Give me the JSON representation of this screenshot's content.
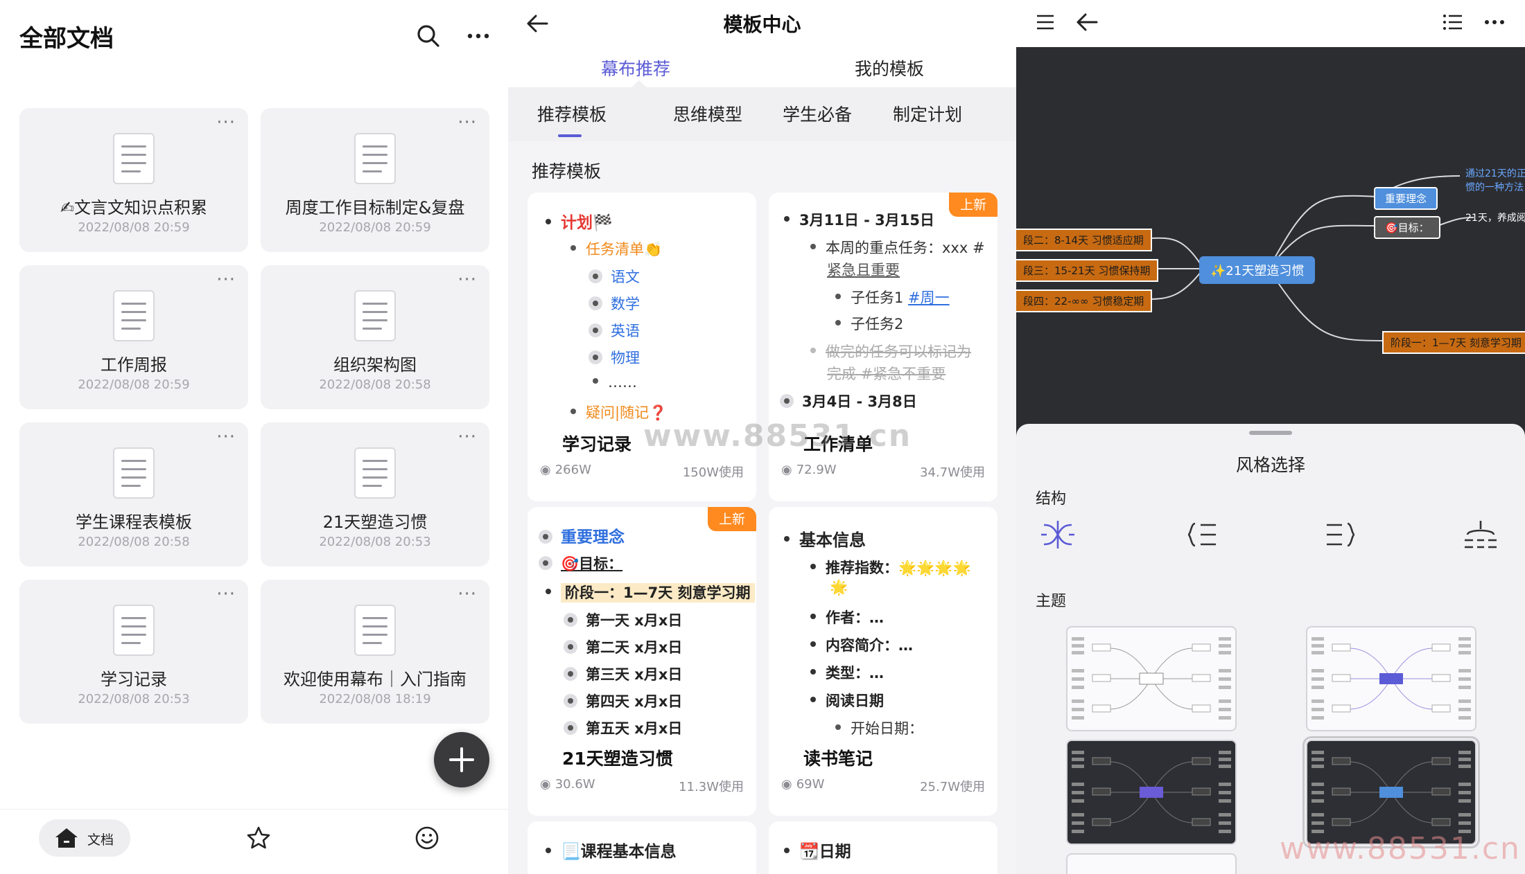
{
  "docs_panel": {
    "title": "全部文档",
    "docs": [
      {
        "name": "✍文言文知识点积累",
        "date": "2022/08/08 20:59"
      },
      {
        "name": "周度工作目标制定&复盘",
        "date": "2022/08/08 20:59"
      },
      {
        "name": "工作周报",
        "date": "2022/08/08 20:59"
      },
      {
        "name": "组织架构图",
        "date": "2022/08/08 20:58"
      },
      {
        "name": "学生课程表模板",
        "date": "2022/08/08 20:58"
      },
      {
        "name": "21天塑造习惯",
        "date": "2022/08/08 20:53"
      },
      {
        "name": "学习记录",
        "date": "2022/08/08 20:53"
      },
      {
        "name": "欢迎使用幕布｜入门指南",
        "date": "2022/08/08 18:19"
      }
    ],
    "more_glyph": "···",
    "tabbar": {
      "docs_label": "文档"
    }
  },
  "template_panel": {
    "title": "模板中心",
    "top_tabs": [
      "幕布推荐",
      "我的模板"
    ],
    "categories": [
      "推荐模板",
      "思维模型",
      "学生必备",
      "制定计划"
    ],
    "section_title": "推荐模板",
    "badge_new": "上新",
    "templates": [
      {
        "name": "学习记录",
        "views": "266W",
        "uses": "150W使用"
      },
      {
        "name": "工作清单",
        "views": "72.9W",
        "uses": "34.7W使用"
      },
      {
        "name": "21天塑造习惯",
        "views": "30.6W",
        "uses": "11.3W使用"
      },
      {
        "name": "读书笔记",
        "views": "69W",
        "uses": "25.7W使用"
      }
    ],
    "preview_study": {
      "plan": "计划🏁",
      "tasks": "任务清单👏",
      "subjects": [
        "语文",
        "数学",
        "英语",
        "物理",
        "……"
      ],
      "questions": "疑问|随记❓"
    },
    "preview_work": {
      "range1": "3月11日 - 3月15日",
      "focus_line1": "本周的重点任务：xxx #",
      "focus_line2": "紧急且重要",
      "sub1_text": "子任务1 ",
      "sub1_tag": "#周一",
      "sub2": "子任务2",
      "done_line1": "做完的任务可以标记为",
      "done_line2": "完成 #紧急不重要",
      "range2": "3月4日 - 3月8日"
    },
    "preview_habit": {
      "concept": "重要理念",
      "goal": "🎯目标：",
      "stage": "阶段一：1—7天 刻意学习期",
      "days": [
        "第一天 x月x日",
        "第二天 x月x日",
        "第三天 x月x日",
        "第四天 x月x日",
        "第五天 x月x日"
      ]
    },
    "preview_reading": {
      "basic": "基本信息",
      "rating_label": "推荐指数：",
      "rating_stars": "🌟🌟🌟🌟",
      "rating_star5": "🌟",
      "author": "作者：…",
      "intro": "内容简介：…",
      "type": "类型：…",
      "date": "阅读日期",
      "start": "开始日期："
    },
    "bottom_row": [
      "📃课程基本信息",
      "📆日期"
    ]
  },
  "watermark": "www.88531.cn",
  "mindmap_panel": {
    "center": "✨21天塑造习惯",
    "right_nodes": [
      "重要理念",
      "🎯目标："
    ],
    "right_text": [
      "通过21天的正",
      "惯的一种方法",
      "21天，养成阅"
    ],
    "left_nodes": [
      "段二：8-14天  习惯适应期",
      "段三：15-21天 习惯保持期",
      "段四：22-∞∞  习惯稳定期"
    ],
    "bottom_right_node": "阶段一：1—7天 刻意学习期",
    "sheet_title": "风格选择",
    "structure_label": "结构",
    "theme_label": "主题"
  },
  "colors": {
    "accent": "#5b5bd6",
    "badge": "#ff8a1f",
    "orange_text": "#f08a1c",
    "blue_text": "#2f6fdf",
    "red_text": "#e53935",
    "mindmap_bg": "#2c2d31",
    "node_blue": "#4f8fdc",
    "node_orange": "#c76a12"
  }
}
